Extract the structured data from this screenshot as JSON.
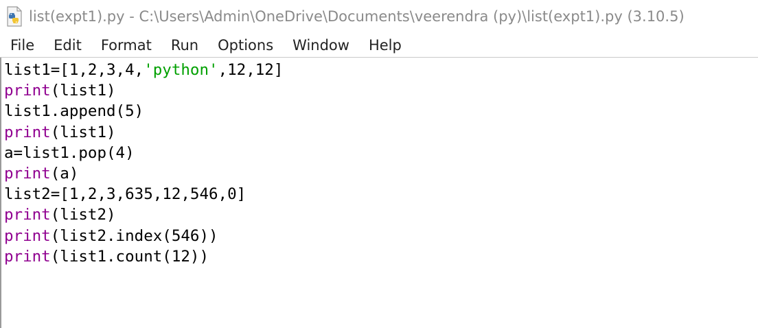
{
  "window": {
    "title": "list(expt1).py - C:\\Users\\Admin\\OneDrive\\Documents\\veerendra (py)\\list(expt1).py (3.10.5)"
  },
  "icons": {
    "app": "python-file-icon"
  },
  "menu": {
    "items": [
      {
        "label": "File"
      },
      {
        "label": "Edit"
      },
      {
        "label": "Format"
      },
      {
        "label": "Run"
      },
      {
        "label": "Options"
      },
      {
        "label": "Window"
      },
      {
        "label": "Help"
      }
    ]
  },
  "colors": {
    "builtin": "#900090",
    "string": "#00a000",
    "text": "#000000"
  },
  "code": {
    "lines": [
      {
        "t1": "list1=[1,2,3,4,",
        "t2": "'python'",
        "t3": ",12,12]"
      },
      {
        "t1": "print",
        "t2": "(list1)"
      },
      {
        "t1": "list1.append(5)"
      },
      {
        "t1": "print",
        "t2": "(list1)"
      },
      {
        "t1": "a=list1.pop(4)"
      },
      {
        "t1": "print",
        "t2": "(a)"
      },
      {
        "t1": "list2=[1,2,3,635,12,546,0]"
      },
      {
        "t1": "print",
        "t2": "(list2)"
      },
      {
        "t1": "print",
        "t2": "(list2.index(546))"
      },
      {
        "t1": "print",
        "t2": "(list1.count(12))"
      }
    ]
  }
}
